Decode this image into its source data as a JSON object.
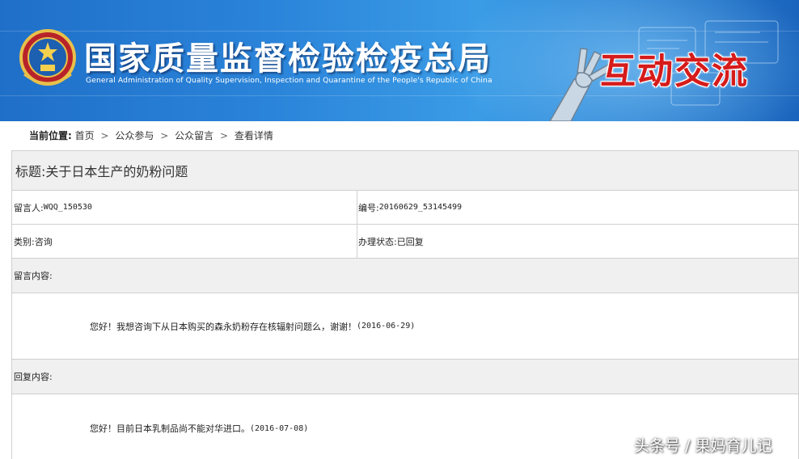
{
  "banner": {
    "title_cn": "国家质量监督检验检疫总局",
    "title_en": "General Administration of Quality Supervision, Inspection and Quarantine of the People's Republic of China",
    "section_title": "互动交流",
    "colors": {
      "primary": "#2b85da",
      "section_red": "#d61b1b"
    }
  },
  "breadcrumb": {
    "lead": "当前位置:",
    "items": [
      "首页",
      "公众参与",
      "公众留言",
      "查看详情"
    ],
    "separator": ">"
  },
  "detail": {
    "subject": "标题:关于日本生产的奶粉问题",
    "author_label": "留言人:",
    "author": "WQQ_150530",
    "number_label": "编号:",
    "number": "20160629_53145499",
    "category_label": "类别:",
    "category": "咨询",
    "status_label": "办理状态:",
    "status": "已回复",
    "message_label": "留言内容:",
    "message": "您好！我想咨询下从日本购买的森永奶粉存在核辐射问题么，谢谢！",
    "message_date": "(2016-06-29)",
    "reply_label": "回复内容:",
    "reply": "您好！目前日本乳制品尚不能对华进口。",
    "reply_date": "(2016-07-08)"
  },
  "watermark": "头条号 / 果妈育儿记"
}
